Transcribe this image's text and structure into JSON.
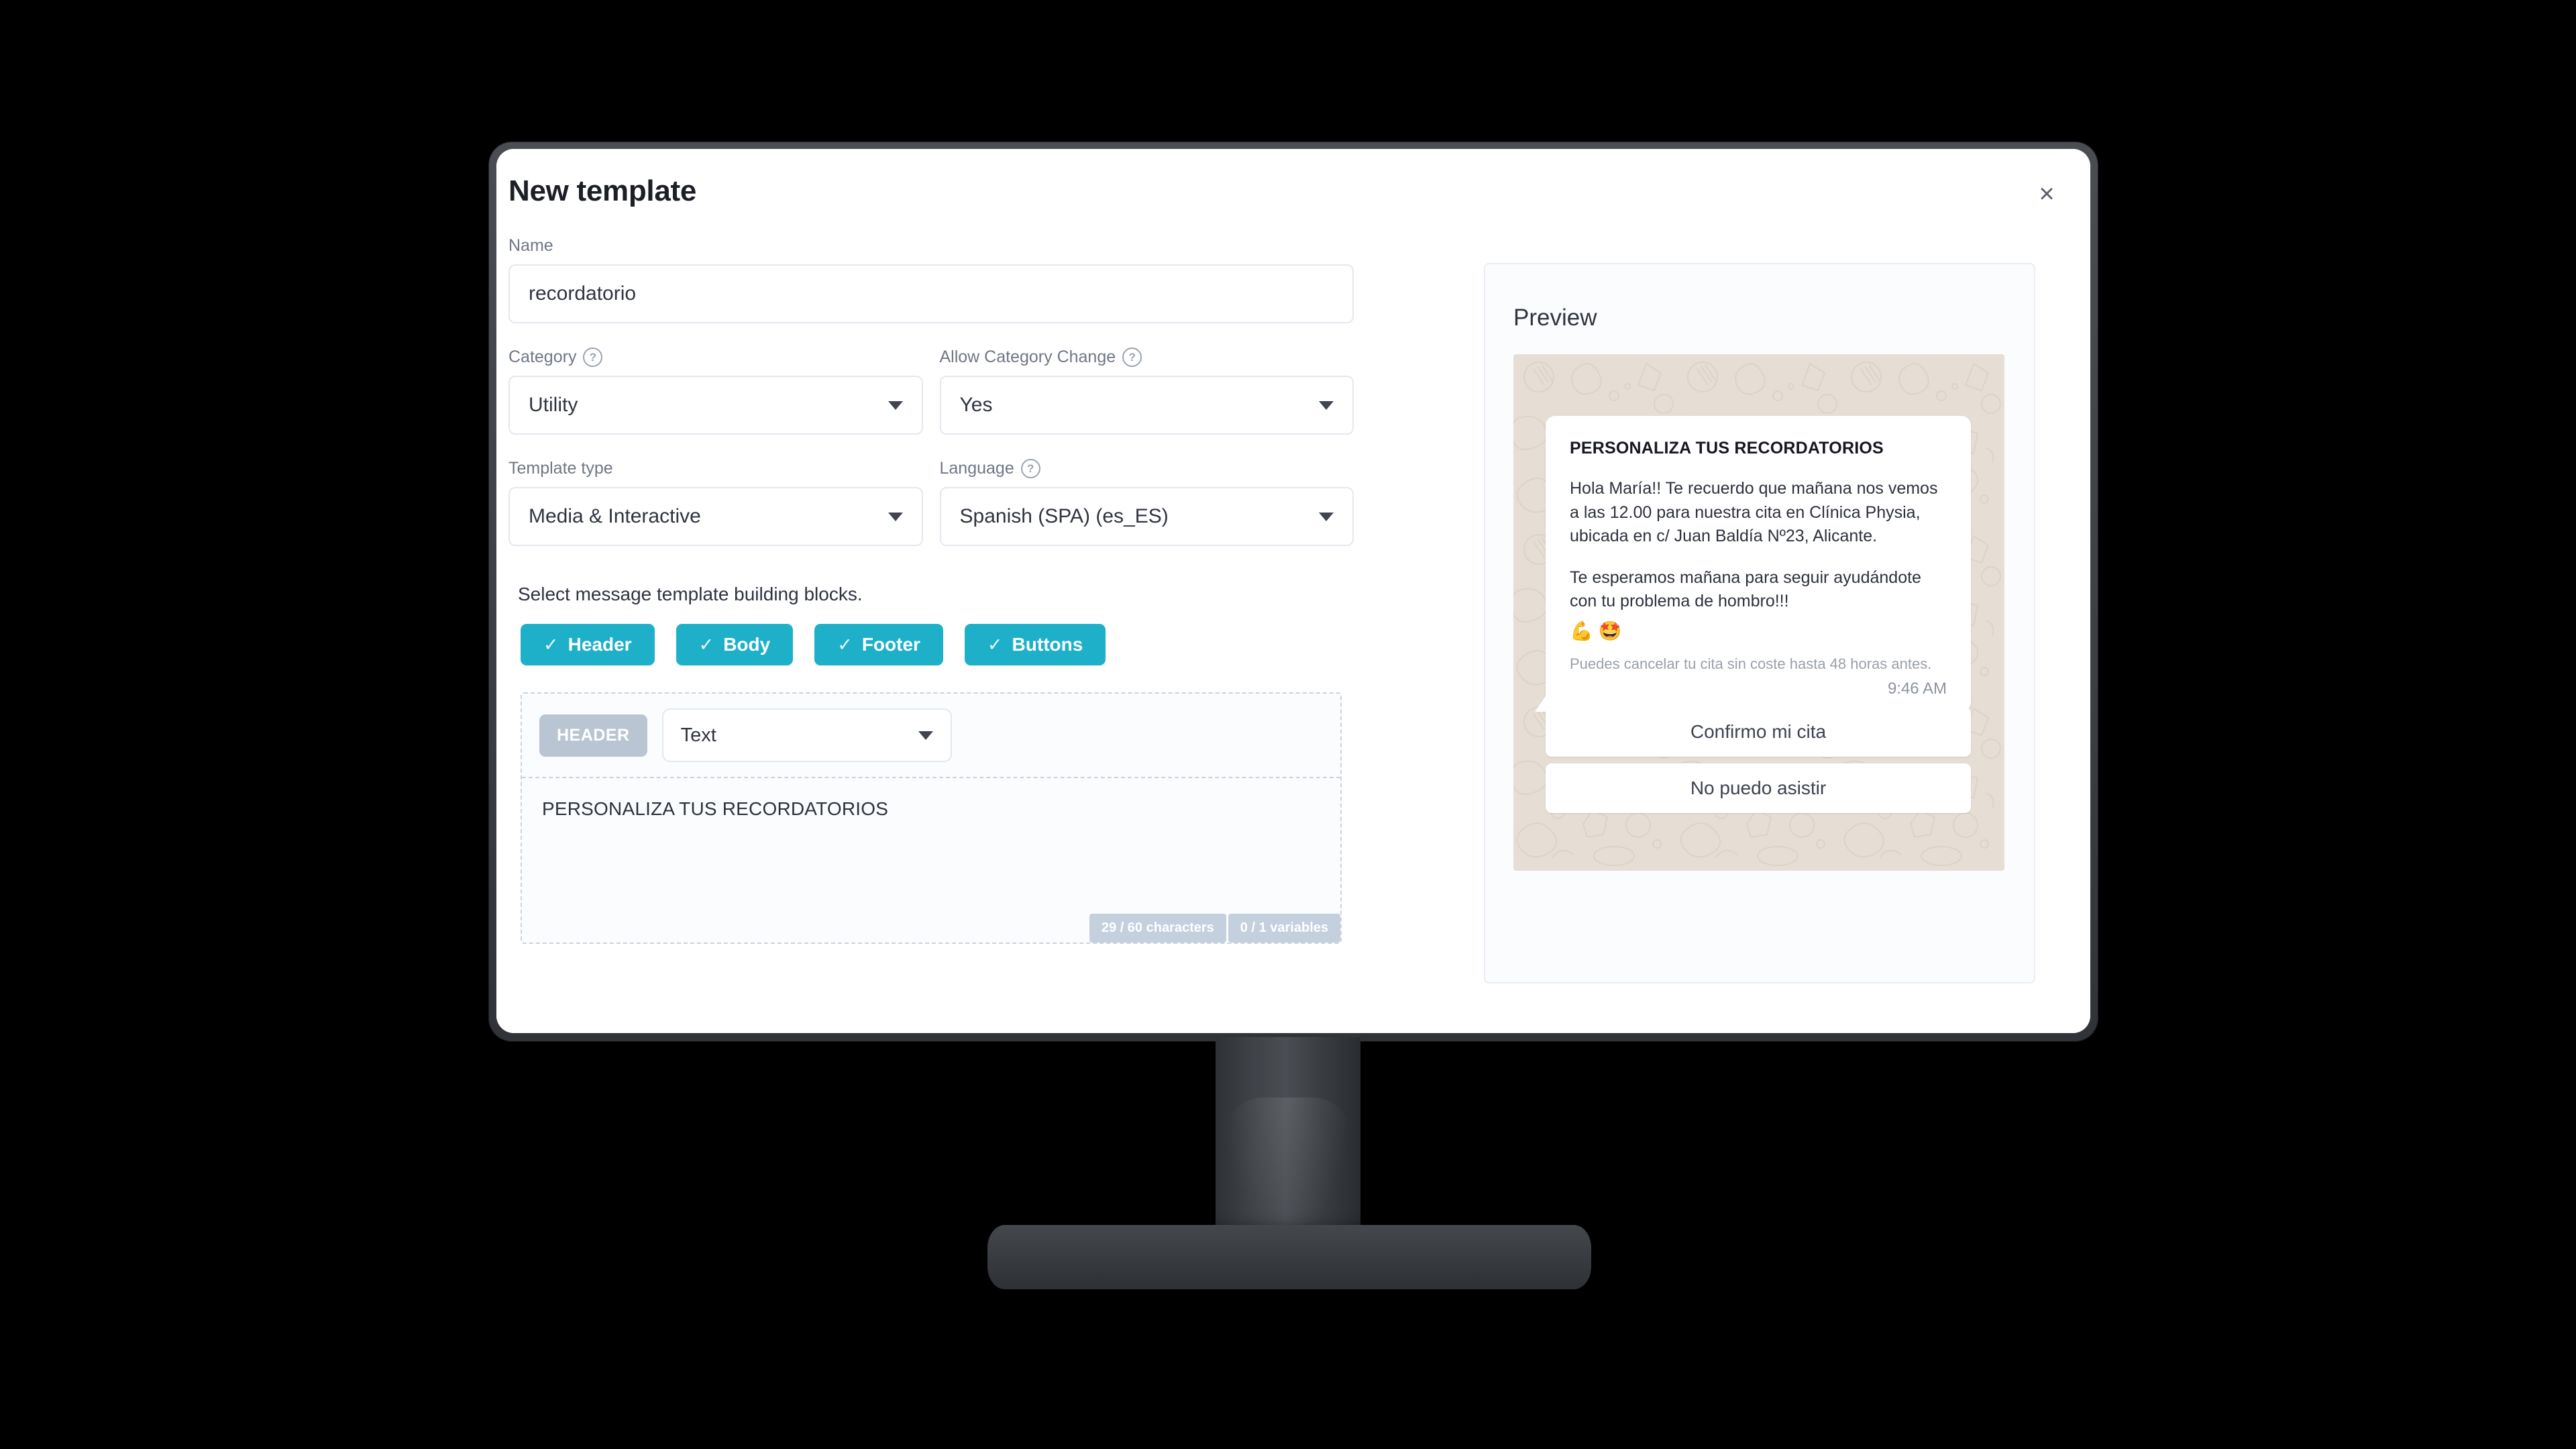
{
  "dialog": {
    "title": "New template",
    "close_label": "×"
  },
  "form": {
    "name": {
      "label": "Name",
      "value": "recordatorio",
      "placeholder": "Name"
    },
    "category": {
      "label": "Category",
      "help": "?",
      "value": "Utility"
    },
    "allow_category_change": {
      "label": "Allow Category Change",
      "help": "?",
      "value": "Yes"
    },
    "template_type": {
      "label": "Template type",
      "value": "Media & Interactive"
    },
    "language": {
      "label": "Language",
      "help": "?",
      "value": "Spanish (SPA) (es_ES)"
    }
  },
  "blocks": {
    "instruction": "Select message template building blocks.",
    "items": [
      {
        "label": "Header",
        "check": "✓"
      },
      {
        "label": "Body",
        "check": "✓"
      },
      {
        "label": "Footer",
        "check": "✓"
      },
      {
        "label": "Buttons",
        "check": "✓"
      }
    ]
  },
  "header_block": {
    "badge": "HEADER",
    "type_value": "Text",
    "editor_text": "PERSONALIZA TUS RECORDATORIOS",
    "char_counter": "29 / 60 characters",
    "var_counter": "0 / 1 variables"
  },
  "preview": {
    "title": "Preview",
    "message": {
      "header": "PERSONALIZA TUS RECORDATORIOS",
      "body_paragraphs": [
        "Hola María!! Te recuerdo que mañana nos vemos a las 12.00 para nuestra cita en Clínica Physia, ubicada en c/ Juan Baldía Nº23, Alicante.",
        "Te esperamos mañana para seguir ayudándote con tu problema de hombro!!!"
      ],
      "emojis": "💪 🤩",
      "footer": "Puedes cancelar tu cita sin coste hasta 48 horas antes.",
      "time": "9:46 AM"
    },
    "buttons": [
      {
        "label": "Confirmo mi cita"
      },
      {
        "label": "No puedo asistir"
      }
    ]
  },
  "colors": {
    "accent_teal": "#1fb0c9",
    "badge_grey": "#b9c5d2",
    "counter_grey": "#c4d0dd",
    "whatsapp_bg": "#e6ded4",
    "bezel": "#3c3f44"
  }
}
